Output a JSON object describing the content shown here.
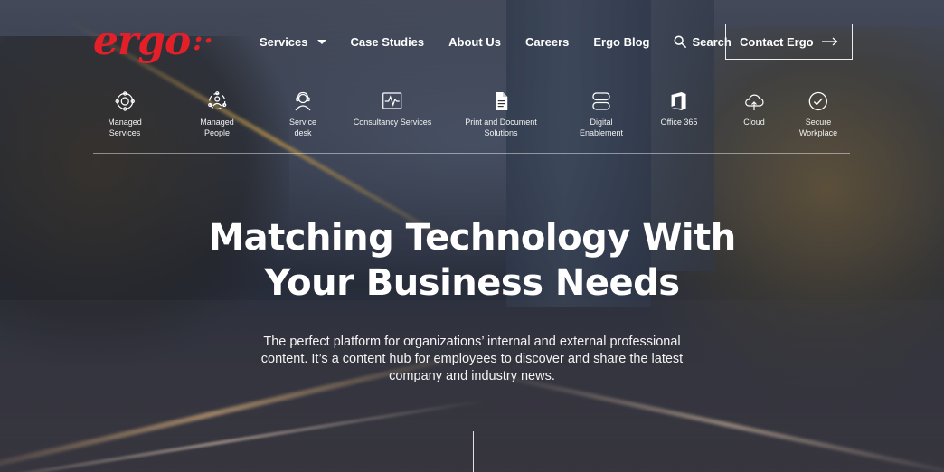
{
  "brand": {
    "logo_text": "ergo",
    "logo_dots": ":·",
    "color": "#e3202a"
  },
  "nav": {
    "items": [
      {
        "label": "Services",
        "has_dropdown": true
      },
      {
        "label": "Case Studies"
      },
      {
        "label": "About Us"
      },
      {
        "label": "Careers"
      },
      {
        "label": "Ergo Blog"
      }
    ],
    "search_label": "Search",
    "contact_label": "Contact Ergo"
  },
  "services": [
    {
      "label": "Managed\nServices",
      "icon": "managed-services-icon"
    },
    {
      "label": "Managed\nPeople",
      "icon": "managed-people-icon"
    },
    {
      "label": "Service\ndesk",
      "icon": "service-desk-icon"
    },
    {
      "label": "Consultancy Services",
      "icon": "consultancy-icon"
    },
    {
      "label": "Print and Document\nSolutions",
      "icon": "document-icon"
    },
    {
      "label": "Digital\nEnablement",
      "icon": "digital-enablement-icon"
    },
    {
      "label": "Office 365",
      "icon": "office-365-icon"
    },
    {
      "label": "Cloud",
      "icon": "cloud-icon"
    },
    {
      "label": "Secure\nWorkplace",
      "icon": "secure-workplace-icon"
    }
  ],
  "hero": {
    "title_line1": "Matching Technology With",
    "title_line2": "Your Business Needs",
    "subtitle": "The perfect platform for organizations’ internal and external professional content. It’s a content hub for employees to discover and share the latest company and industry news."
  }
}
